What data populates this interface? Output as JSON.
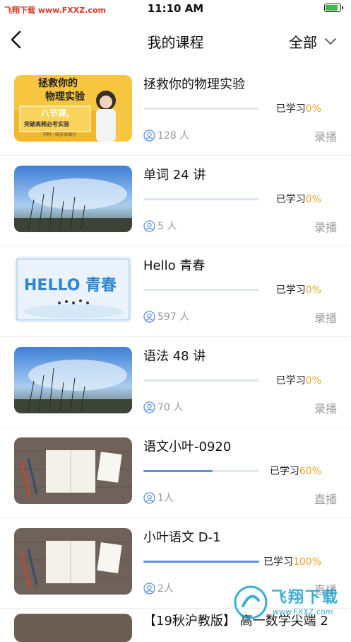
{
  "status": {
    "carrier": "飞翔下载 www.FXXZ.com",
    "time": "11:10 AM"
  },
  "nav": {
    "title": "我的课程",
    "filter": "全部"
  },
  "courses": [
    {
      "name": "拯救你的物理实验",
      "progress_label": "已学习",
      "progress_pct": "0%",
      "progress": 0,
      "users": "128 人",
      "mode": "录播",
      "thumb": "physics",
      "thumb_text": {
        "line1": "拯救你的",
        "line2": "物理实验",
        "line3": "八节课,",
        "line4": "突破高频必考实验",
        "line5": "冲刺一线实验满分"
      }
    },
    {
      "name": "单词 24 讲",
      "progress_label": "已学习",
      "progress_pct": "0%",
      "progress": 0,
      "users": "5 人",
      "mode": "录播",
      "thumb": "sky"
    },
    {
      "name": "Hello 青春",
      "progress_label": "已学习",
      "progress_pct": "0%",
      "progress": 0,
      "users": "597 人",
      "mode": "录播",
      "thumb": "hello",
      "thumb_text": {
        "line1": "HELLO 青春"
      }
    },
    {
      "name": "语法 48 讲",
      "progress_label": "已学习",
      "progress_pct": "0%",
      "progress": 0,
      "users": "70 人",
      "mode": "录播",
      "thumb": "sky"
    },
    {
      "name": "语文小叶-0920",
      "progress_label": "已学习",
      "progress_pct": "60%",
      "progress": 0.6,
      "users": "1人",
      "mode": "直播",
      "thumb": "desk"
    },
    {
      "name": "小叶语文 D-1",
      "progress_label": "已学习",
      "progress_pct": "100%",
      "progress": 1.0,
      "users": "2人",
      "mode": "直播",
      "thumb": "desk"
    }
  ],
  "partial_course": {
    "name": "【19秋沪教版】 高一数学尖端 2"
  },
  "watermark": {
    "title": "飞翔下载",
    "url": "www.FXXZ.com"
  },
  "colors": {
    "accent_blue": "#5b8fe0",
    "progress_orange": "#f0a32b",
    "muted": "#9a9a9a"
  }
}
